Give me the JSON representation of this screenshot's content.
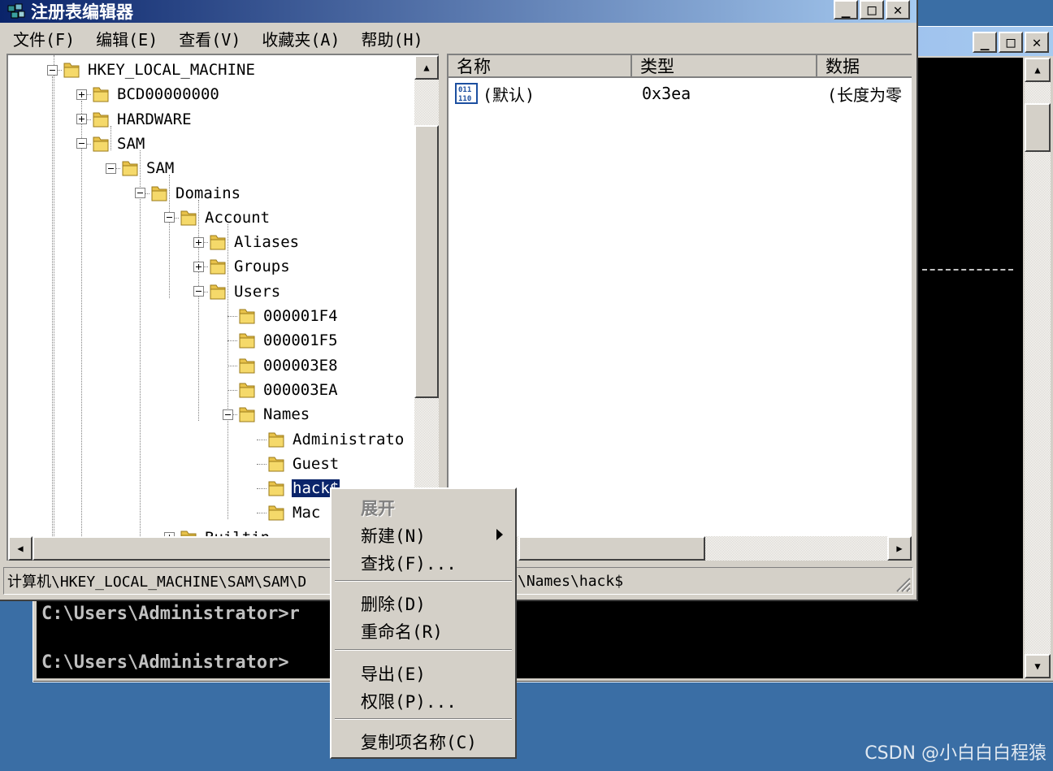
{
  "console": {
    "lines": [
      "C:\\Users\\Administrator>r",
      "C:\\Users\\Administrator>"
    ]
  },
  "regedit": {
    "title": "注册表编辑器",
    "menu": [
      "文件(F)",
      "编辑(E)",
      "查看(V)",
      "收藏夹(A)",
      "帮助(H)"
    ],
    "tree": [
      {
        "label": "HKEY_LOCAL_MACHINE",
        "expander": "minus"
      },
      {
        "label": "BCD00000000",
        "expander": "plus"
      },
      {
        "label": "HARDWARE",
        "expander": "plus"
      },
      {
        "label": "SAM",
        "expander": "minus"
      },
      {
        "label": "SAM",
        "expander": "minus"
      },
      {
        "label": "Domains",
        "expander": "minus"
      },
      {
        "label": "Account",
        "expander": "minus"
      },
      {
        "label": "Aliases",
        "expander": "plus"
      },
      {
        "label": "Groups",
        "expander": "plus"
      },
      {
        "label": "Users",
        "expander": "minus"
      },
      {
        "label": "000001F4",
        "expander": "none"
      },
      {
        "label": "000001F5",
        "expander": "none"
      },
      {
        "label": "000003E8",
        "expander": "none"
      },
      {
        "label": "000003EA",
        "expander": "none"
      },
      {
        "label": "Names",
        "expander": "minus"
      },
      {
        "label": "Administrato",
        "expander": "none"
      },
      {
        "label": "Guest",
        "expander": "none"
      },
      {
        "label": "hack$",
        "expander": "none",
        "selected": true
      },
      {
        "label": "Mac",
        "expander": "none"
      },
      {
        "label": "Builtin",
        "expander": "plus"
      }
    ],
    "list": {
      "columns": [
        "名称",
        "类型",
        "数据"
      ],
      "rows": [
        {
          "name": "(默认)",
          "type": "0x3ea",
          "data": "(长度为零"
        }
      ]
    },
    "status": "计算机\\HKEY_LOCAL_MACHINE\\SAM\\SAM\\D",
    "status_tail": "\\Names\\hack$"
  },
  "context_menu": {
    "expand": "展开",
    "new": "新建(N)",
    "find": "查找(F)...",
    "delete": "删除(D)",
    "rename": "重命名(R)",
    "export": "导出(E)",
    "permissions": "权限(P)...",
    "copy_key_name": "复制项名称(C)"
  },
  "watermark": "CSDN @小白白白程猿"
}
